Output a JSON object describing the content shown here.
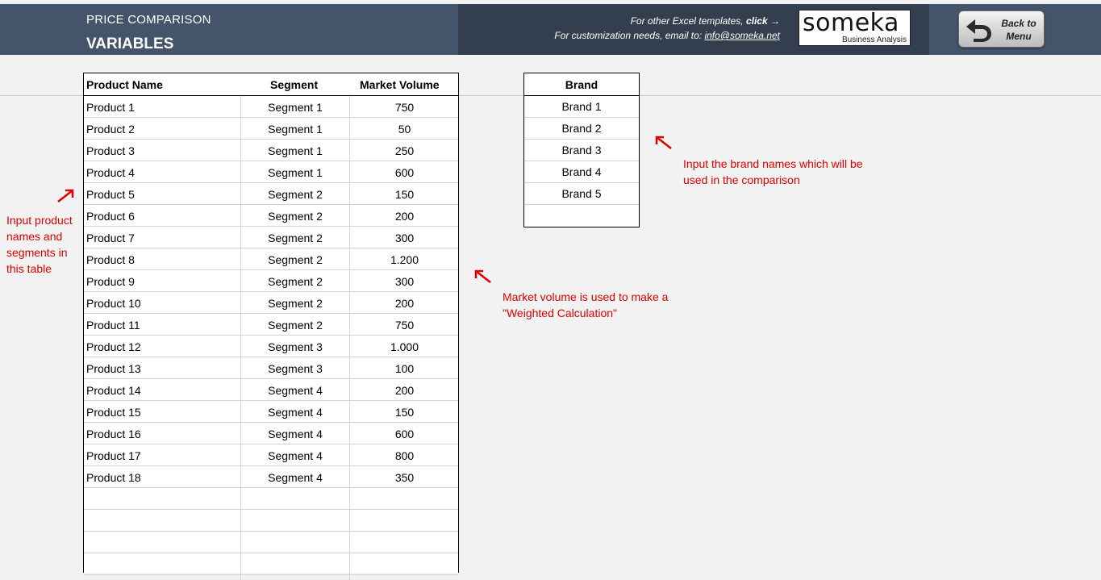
{
  "header": {
    "app_title": "PRICE COMPARISON",
    "page_title": "VARIABLES",
    "promo_templates_prefix": "For other Excel templates, ",
    "promo_templates_link": "click",
    "promo_templates_arrow": "→",
    "promo_custom_prefix": "For customization needs, email to: ",
    "promo_custom_email": "info@someka.net",
    "logo_word": "someka",
    "logo_sub": "Business Analysis",
    "back_button_label": "Back to Menu",
    "colors": {
      "band": "#44546a",
      "band_dark": "#333f4f"
    }
  },
  "products_table": {
    "headers": {
      "name": "Product Name",
      "segment": "Segment",
      "volume": "Market Volume"
    },
    "rows": [
      {
        "name": "Product 1",
        "segment": "Segment 1",
        "volume": "750"
      },
      {
        "name": "Product 2",
        "segment": "Segment 1",
        "volume": "50"
      },
      {
        "name": "Product 3",
        "segment": "Segment 1",
        "volume": "250"
      },
      {
        "name": "Product 4",
        "segment": "Segment 1",
        "volume": "600"
      },
      {
        "name": "Product 5",
        "segment": "Segment 2",
        "volume": "150"
      },
      {
        "name": "Product 6",
        "segment": "Segment 2",
        "volume": "200"
      },
      {
        "name": "Product 7",
        "segment": "Segment 2",
        "volume": "300"
      },
      {
        "name": "Product 8",
        "segment": "Segment 2",
        "volume": "1.200"
      },
      {
        "name": "Product 9",
        "segment": "Segment 2",
        "volume": "300"
      },
      {
        "name": "Product 10",
        "segment": "Segment 2",
        "volume": "200"
      },
      {
        "name": "Product 11",
        "segment": "Segment 2",
        "volume": "750"
      },
      {
        "name": "Product 12",
        "segment": "Segment 3",
        "volume": "1.000"
      },
      {
        "name": "Product 13",
        "segment": "Segment 3",
        "volume": "100"
      },
      {
        "name": "Product 14",
        "segment": "Segment 4",
        "volume": "200"
      },
      {
        "name": "Product 15",
        "segment": "Segment 4",
        "volume": "150"
      },
      {
        "name": "Product 16",
        "segment": "Segment 4",
        "volume": "600"
      },
      {
        "name": "Product 17",
        "segment": "Segment 4",
        "volume": "800"
      },
      {
        "name": "Product 18",
        "segment": "Segment 4",
        "volume": "350"
      },
      {
        "name": "",
        "segment": "",
        "volume": ""
      },
      {
        "name": "",
        "segment": "",
        "volume": ""
      },
      {
        "name": "",
        "segment": "",
        "volume": ""
      },
      {
        "name": "",
        "segment": "",
        "volume": ""
      }
    ]
  },
  "brand_table": {
    "header": "Brand",
    "rows": [
      "Brand 1",
      "Brand 2",
      "Brand 3",
      "Brand 4",
      "Brand 5",
      ""
    ]
  },
  "notes": {
    "brand": "Input the brand names which will be used in the comparison",
    "volume": "Market volume is used to make a \"Weighted Calculation\"",
    "product": "Input product names and segments in this table",
    "color": "#e00000"
  },
  "icons": {
    "back": "back-arrow-icon",
    "annotation_arrow": "red-arrow-icon"
  }
}
